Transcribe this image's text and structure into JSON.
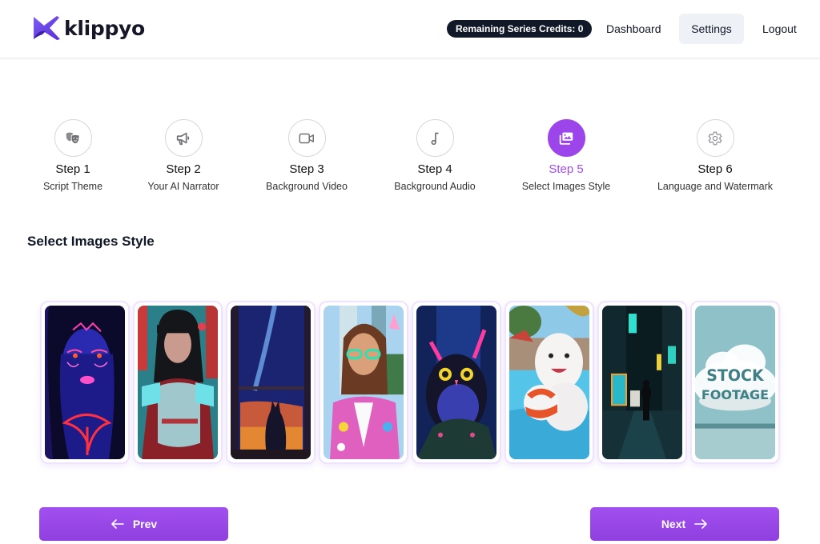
{
  "app": {
    "name": "klippyo",
    "brand_color": "#9b45ea"
  },
  "header": {
    "credits_badge": "Remaining Series Credits: 0",
    "nav": [
      {
        "label": "Dashboard"
      },
      {
        "label": "Settings",
        "active": true
      },
      {
        "label": "Logout"
      }
    ]
  },
  "stepper": {
    "current_step": 5,
    "steps": [
      {
        "title": "Step 1",
        "subtitle": "Script Theme",
        "icon": "theater-masks-icon"
      },
      {
        "title": "Step 2",
        "subtitle": "Your AI Narrator",
        "icon": "megaphone-icon"
      },
      {
        "title": "Step 3",
        "subtitle": "Background Video",
        "icon": "video-camera-icon"
      },
      {
        "title": "Step 4",
        "subtitle": "Background Audio",
        "icon": "music-note-icon"
      },
      {
        "title": "Step 5",
        "subtitle": "Select Images Style",
        "icon": "images-icon"
      },
      {
        "title": "Step 6",
        "subtitle": "Language and Watermark",
        "icon": "gear-icon"
      }
    ]
  },
  "main": {
    "section_title": "Select Images Style",
    "styles": [
      {
        "name": "neon-glow-portrait"
      },
      {
        "name": "cyberpunk-samurai"
      },
      {
        "name": "anime-night-sky-cat"
      },
      {
        "name": "pop-art-girl"
      },
      {
        "name": "dark-fantasy-owl-creature"
      },
      {
        "name": "cute-3d-seal"
      },
      {
        "name": "cinematic-neon-street"
      },
      {
        "name": "stock-footage",
        "overlay_text": [
          "STOCK",
          "FOOTAGE"
        ]
      }
    ]
  },
  "footer": {
    "prev_label": "Prev",
    "next_label": "Next"
  }
}
